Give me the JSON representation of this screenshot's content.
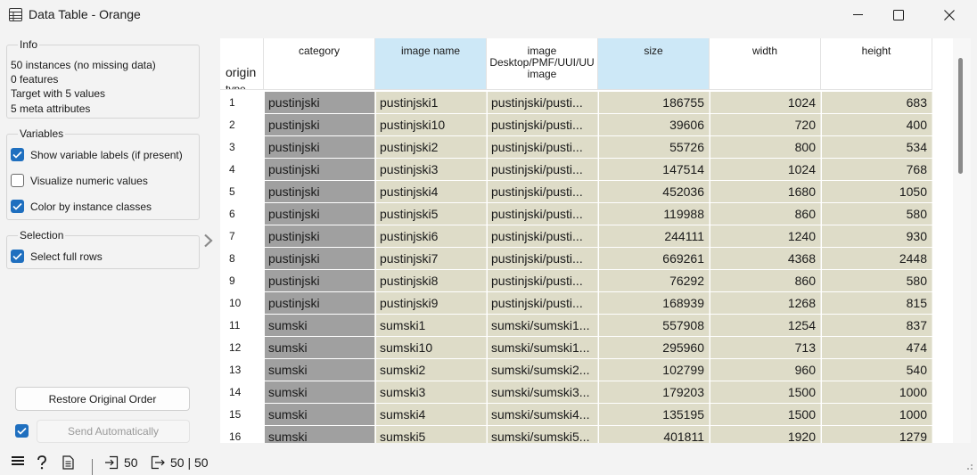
{
  "window": {
    "title": "Data Table - Orange"
  },
  "info": {
    "title": "Info",
    "lines": [
      "50 instances (no missing data)",
      "0  features",
      "Target with 5 values",
      "5 meta attributes"
    ]
  },
  "variables": {
    "title": "Variables",
    "options": [
      {
        "label": "Show variable labels (if present)",
        "checked": true
      },
      {
        "label": "Visualize numeric values",
        "checked": false
      },
      {
        "label": "Color by instance classes",
        "checked": true
      }
    ]
  },
  "selection": {
    "title": "Selection",
    "options": [
      {
        "label": "Select full rows",
        "checked": true
      }
    ]
  },
  "buttons": {
    "restore": "Restore Original Order",
    "send_auto": "Send Automatically",
    "send_auto_checked": true
  },
  "table": {
    "corner": {
      "main": "origin",
      "sub": "type"
    },
    "columns": [
      {
        "name": "category",
        "selected": false
      },
      {
        "name": "image name",
        "selected": true
      },
      {
        "name": "image",
        "sub": "Desktop/PMF/UUI/UU",
        "sub2": "image",
        "selected": false
      },
      {
        "name": "size",
        "selected": true
      },
      {
        "name": "width",
        "selected": false
      },
      {
        "name": "height",
        "selected": false
      }
    ],
    "rows": [
      [
        "1",
        "pustinjski",
        "pustinjski1",
        "pustinjski/pusti...",
        "186755",
        "1024",
        "683"
      ],
      [
        "2",
        "pustinjski",
        "pustinjski10",
        "pustinjski/pusti...",
        "39606",
        "720",
        "400"
      ],
      [
        "3",
        "pustinjski",
        "pustinjski2",
        "pustinjski/pusti...",
        "55726",
        "800",
        "534"
      ],
      [
        "4",
        "pustinjski",
        "pustinjski3",
        "pustinjski/pusti...",
        "147514",
        "1024",
        "768"
      ],
      [
        "5",
        "pustinjski",
        "pustinjski4",
        "pustinjski/pusti...",
        "452036",
        "1680",
        "1050"
      ],
      [
        "6",
        "pustinjski",
        "pustinjski5",
        "pustinjski/pusti...",
        "119988",
        "860",
        "580"
      ],
      [
        "7",
        "pustinjski",
        "pustinjski6",
        "pustinjski/pusti...",
        "244111",
        "1240",
        "930"
      ],
      [
        "8",
        "pustinjski",
        "pustinjski7",
        "pustinjski/pusti...",
        "669261",
        "4368",
        "2448"
      ],
      [
        "9",
        "pustinjski",
        "pustinjski8",
        "pustinjski/pusti...",
        "76292",
        "860",
        "580"
      ],
      [
        "10",
        "pustinjski",
        "pustinjski9",
        "pustinjski/pusti...",
        "168939",
        "1268",
        "815"
      ],
      [
        "11",
        "sumski",
        "sumski1",
        "sumski/sumski1...",
        "557908",
        "1254",
        "837"
      ],
      [
        "12",
        "sumski",
        "sumski10",
        "sumski/sumski1...",
        "295960",
        "713",
        "474"
      ],
      [
        "13",
        "sumski",
        "sumski2",
        "sumski/sumski2...",
        "102799",
        "960",
        "540"
      ],
      [
        "14",
        "sumski",
        "sumski3",
        "sumski/sumski3...",
        "179203",
        "1500",
        "1000"
      ],
      [
        "15",
        "sumski",
        "sumski4",
        "sumski/sumski4...",
        "135195",
        "1500",
        "1000"
      ],
      [
        "16",
        "sumski",
        "sumski5",
        "sumski/sumski5...",
        "401811",
        "1920",
        "1279"
      ]
    ]
  },
  "status": {
    "input_count": "50",
    "output_count": "50 | 50"
  },
  "colors": {
    "accent": "#1f6fbf",
    "category_cell": "#a0a0a0",
    "meta_cell": "#dedcc8",
    "selected_header": "#cde8f7"
  }
}
